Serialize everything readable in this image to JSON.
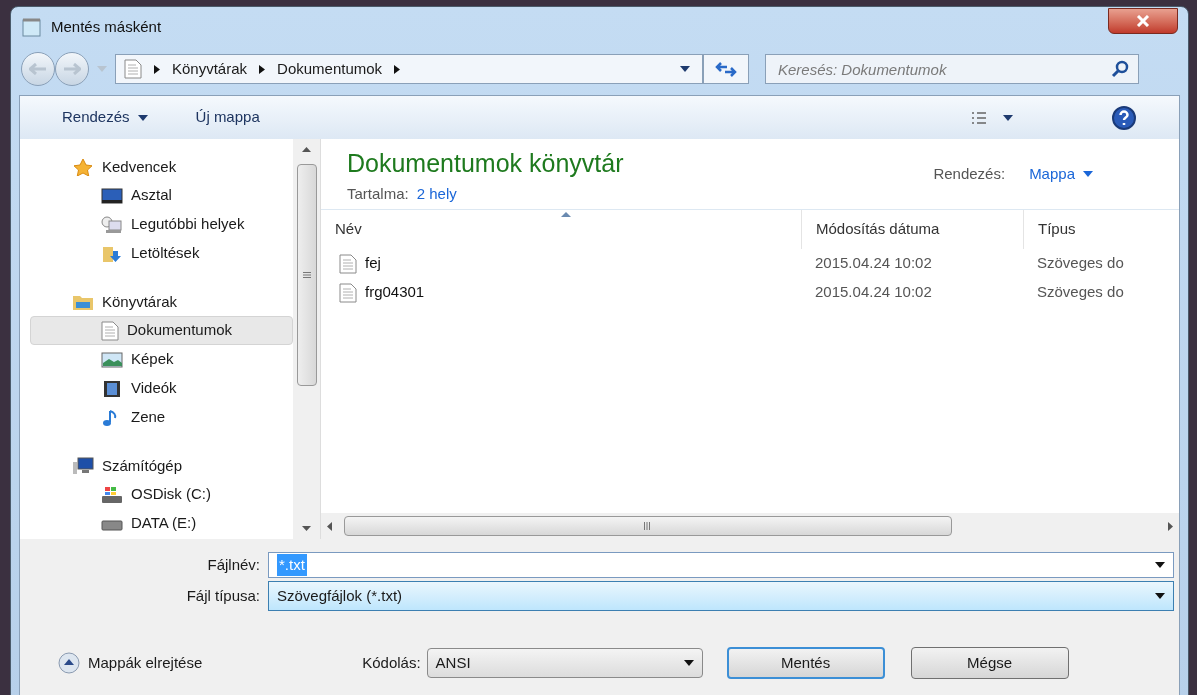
{
  "window": {
    "title": "Mentés másként"
  },
  "address": {
    "crumbs": [
      "Könyvtárak",
      "Dokumentumok"
    ]
  },
  "search": {
    "placeholder": "Keresés: Dokumentumok"
  },
  "toolbar": {
    "organize": "Rendezés",
    "new_folder": "Új mappa"
  },
  "sidebar": {
    "groups": [
      {
        "label": "Kedvencek",
        "selected": false,
        "children": [
          {
            "label": "Asztal",
            "selected": false
          },
          {
            "label": "Legutóbbi helyek",
            "selected": false
          },
          {
            "label": "Letöltések",
            "selected": false
          }
        ]
      },
      {
        "label": "Könyvtárak",
        "selected": false,
        "children": [
          {
            "label": "Dokumentumok",
            "selected": true
          },
          {
            "label": "Képek",
            "selected": false
          },
          {
            "label": "Videók",
            "selected": false
          },
          {
            "label": "Zene",
            "selected": false
          }
        ]
      },
      {
        "label": "Számítógép",
        "selected": false,
        "children": [
          {
            "label": "OSDisk (C:)",
            "selected": false
          },
          {
            "label": "DATA (E:)",
            "selected": false
          }
        ]
      }
    ]
  },
  "library": {
    "title": "Dokumentumok könyvtár",
    "contents_label": "Tartalma:",
    "contents_link": "2 hely",
    "arrange_label": "Rendezés:",
    "arrange_value": "Mappa"
  },
  "table": {
    "columns": [
      {
        "label": "Név",
        "sorted": true
      },
      {
        "label": "Módosítás dátuma",
        "sorted": false
      },
      {
        "label": "Típus",
        "sorted": false
      }
    ],
    "rows": [
      {
        "name": "fej",
        "date": "2015.04.24 10:02",
        "type": "Szöveges do"
      },
      {
        "name": "frg04301",
        "date": "2015.04.24 10:02",
        "type": "Szöveges do"
      }
    ]
  },
  "form": {
    "filename_label": "Fájlnév:",
    "filename": "*.txt",
    "filename_selected": true,
    "filetype_label": "Fájl típusa:",
    "filetype": "Szövegfájlok (*.txt)",
    "encoding_label": "Kódolás:",
    "encoding": "ANSI"
  },
  "footer": {
    "hide_folders": "Mappák elrejtése",
    "buttons": [
      {
        "label": "Mentés",
        "default": true
      },
      {
        "label": "Mégse",
        "default": false
      }
    ]
  }
}
